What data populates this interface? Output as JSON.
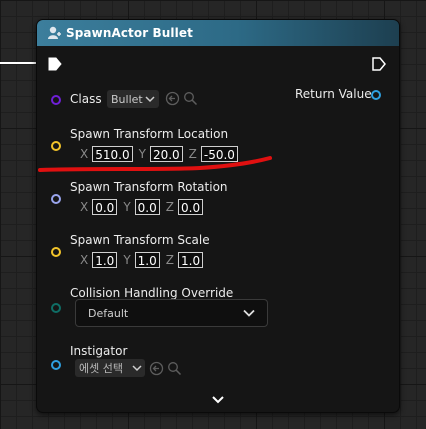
{
  "node": {
    "title": "SpawnActor Bullet",
    "header_color": "#3c7e9c"
  },
  "class": {
    "label": "Class",
    "selected": "Bullet",
    "pin_color": "#6f1fd6"
  },
  "return_value": {
    "label": "Return Value",
    "pin_color": "#2fa0e0"
  },
  "spawn_location": {
    "label": "Spawn Transform Location",
    "pin_color": "#f2c42a",
    "x_label": "X",
    "x": "510.0",
    "y_label": "Y",
    "y": "20.0",
    "z_label": "Z",
    "z": "-50.0"
  },
  "spawn_rotation": {
    "label": "Spawn Transform Rotation",
    "pin_color": "#9aa5ee",
    "x_label": "X",
    "x": "0.0",
    "y_label": "Y",
    "y": "0.0",
    "z_label": "Z",
    "z": "0.0"
  },
  "spawn_scale": {
    "label": "Spawn Transform Scale",
    "pin_color": "#f2c42a",
    "x_label": "X",
    "x": "1.0",
    "y_label": "Y",
    "y": "1.0",
    "z_label": "Z",
    "z": "1.0"
  },
  "collision": {
    "label": "Collision Handling Override",
    "selected": "Default",
    "pin_color": "#0f6e66"
  },
  "instigator": {
    "label": "Instigator",
    "selected": "에셋 선택",
    "pin_color": "#2fa0e0"
  },
  "annotation": {
    "color": "#e01010"
  },
  "icons": {
    "header": "spawn-actor-icon",
    "expand": "chevron-down-icon",
    "use_selected": "arrow-left-circle-icon",
    "browse": "search-icon"
  }
}
